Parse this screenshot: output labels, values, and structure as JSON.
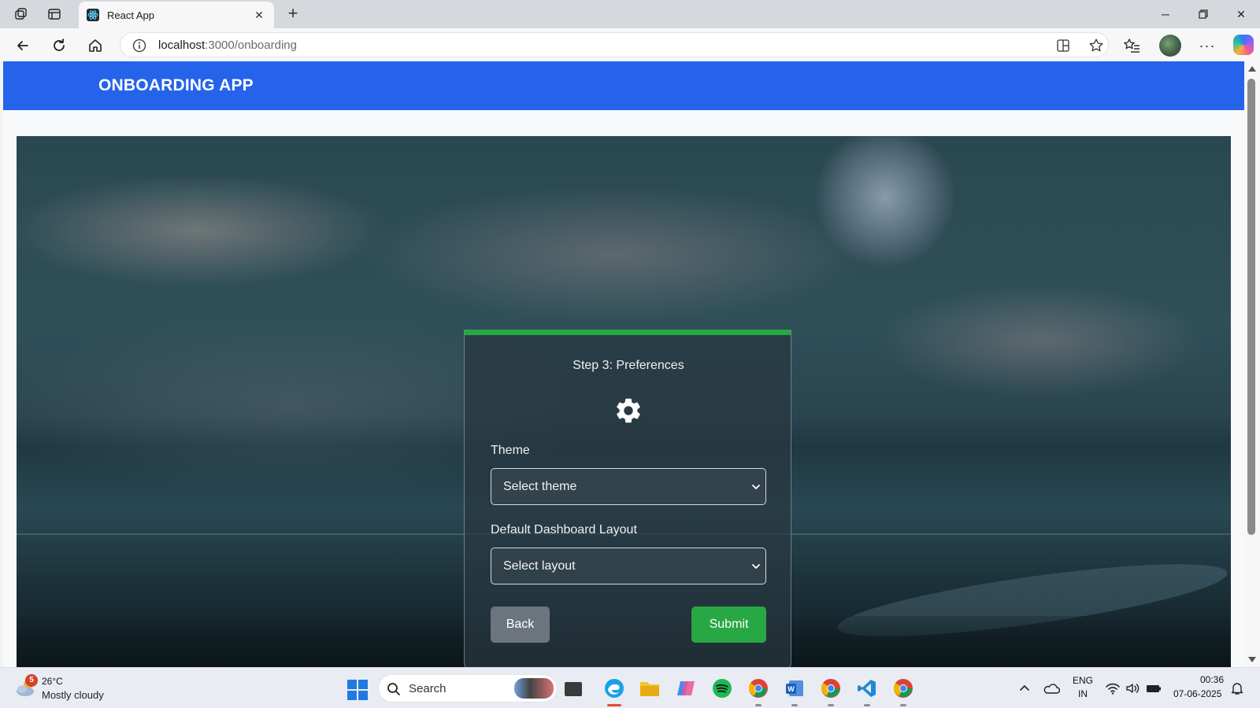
{
  "browser": {
    "tab_title": "React App",
    "url_host": "localhost",
    "url_path": ":3000/onboarding"
  },
  "app": {
    "brand": "ONBOARDING APP"
  },
  "card": {
    "title": "Step 3: Preferences",
    "progress_fraction": 1.0,
    "theme_label": "Theme",
    "theme_value": "Select theme",
    "layout_label": "Default Dashboard Layout",
    "layout_value": "Select layout",
    "back_label": "Back",
    "submit_label": "Submit"
  },
  "taskbar": {
    "weather_badge": "5",
    "weather_temp": "26°C",
    "weather_desc": "Mostly cloudy",
    "search_label": "Search",
    "lang_line1": "ENG",
    "lang_line2": "IN",
    "time": "00:36",
    "date": "07-06-2025"
  },
  "colors": {
    "header_blue": "#2563eb",
    "progress_green": "#28a745",
    "back_gray": "#6c757d",
    "submit_green": "#28a745"
  },
  "icons": {
    "card_icon": "gear-icon",
    "select_caret": "chevron-down-icon"
  }
}
